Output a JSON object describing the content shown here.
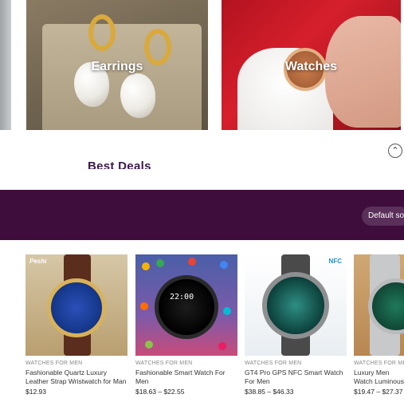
{
  "categories": [
    {
      "label": "Earrings"
    },
    {
      "label": "Watches"
    }
  ],
  "section": {
    "title": "Best Deals"
  },
  "banner": {
    "sort_label": "Default sorting"
  },
  "products": [
    {
      "category": "WATCHES FOR MEN",
      "name": "Fashionable Quartz Luxury Leather Strap Wristwatch for Man",
      "price": "$12.93",
      "brand_text": "Peshi"
    },
    {
      "category": "WATCHES FOR MEN",
      "name": "Fashionable Smart Watch For Men",
      "price": "$18.63 – $22.55",
      "screen_text": "22:00"
    },
    {
      "category": "WATCHES FOR MEN",
      "name": "GT4 Pro GPS NFC Smart Watch For Men",
      "price": "$38.85 – $46.33",
      "badge_text": "NFC"
    },
    {
      "category": "WATCHES FOR MEN",
      "name": "Luxury Men Watch Luminous Stainless",
      "price": "$19.47 – $27.37"
    }
  ],
  "colors": {
    "banner": "#3e0d3c",
    "accent": "#3b1a4a"
  }
}
